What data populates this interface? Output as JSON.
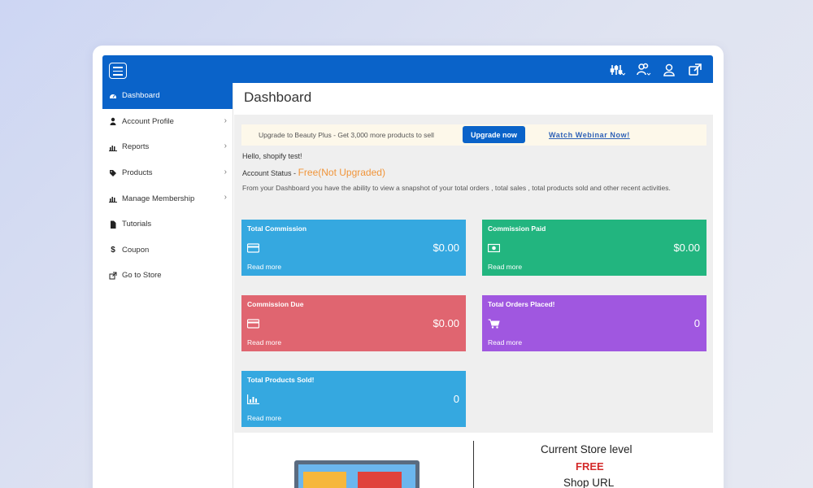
{
  "topbar": {
    "icons": [
      "filter-icon",
      "users-icon",
      "user-icon",
      "external-link-icon"
    ]
  },
  "sidebar": {
    "items": [
      {
        "label": "Dashboard",
        "icon": "dashboard-icon",
        "active": true
      },
      {
        "label": "Account Profile",
        "icon": "user-icon"
      },
      {
        "label": "Reports",
        "icon": "bar-chart-icon"
      },
      {
        "label": "Products",
        "icon": "tag-icon"
      },
      {
        "label": "Manage Membership",
        "icon": "bar-chart-icon"
      },
      {
        "label": "Tutorials",
        "icon": "file-icon"
      },
      {
        "label": "Coupon",
        "icon": "dollar-icon"
      },
      {
        "label": "Go to Store",
        "icon": "external-link-icon"
      }
    ]
  },
  "main": {
    "title": "Dashboard",
    "upgrade": {
      "text": "Upgrade to Beauty Plus - Get 3,000 more products to sell",
      "button": "Upgrade now",
      "webinar": "Watch Webinar Now!"
    },
    "hello": "Hello, shopify test!",
    "status_label": "Account Status -",
    "status_value": "Free(Not Upgraded)",
    "description": "From your Dashboard you have the ability to view a snapshot of your total orders , total sales , total products sold and other recent activities.",
    "cards": [
      {
        "title": "Total Commission",
        "value": "$0.00",
        "more": "Read more",
        "icon": "credit-card-icon",
        "color": "#35a8e0"
      },
      {
        "title": "Commission Paid",
        "value": "$0.00",
        "more": "Read more",
        "icon": "money-icon",
        "color": "#22b57f"
      },
      {
        "title": "Commission Due",
        "value": "$0.00",
        "more": "Read more",
        "icon": "credit-card-icon",
        "color": "#e06570"
      },
      {
        "title": "Total Orders Placed!",
        "value": "0",
        "more": "Read more",
        "icon": "cart-icon",
        "color": "#a057e0"
      },
      {
        "title": "Total Products Sold!",
        "value": "0",
        "more": "Read more",
        "icon": "bar-chart-icon",
        "color": "#35a8e0"
      }
    ],
    "store": {
      "level_label": "Current Store level",
      "level_value": "FREE",
      "url_label": "Shop URL"
    }
  },
  "colors": {
    "accent": "#0a63c9",
    "status": "#f0953a",
    "free": "#d42a2a"
  }
}
